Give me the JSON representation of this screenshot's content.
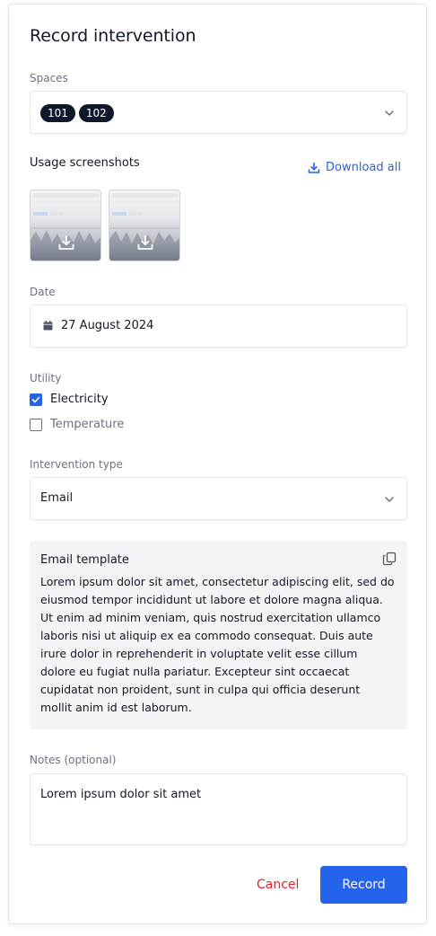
{
  "modal": {
    "title": "Record intervention"
  },
  "spaces": {
    "label": "Spaces",
    "chips": [
      "101",
      "102"
    ],
    "icon": "chevron-down-icon"
  },
  "screenshots": {
    "label": "Usage screenshots",
    "download_all_label": "Download all",
    "count": 2
  },
  "date": {
    "label": "Date",
    "value": "27 August 2024",
    "icon": "calendar-icon"
  },
  "utility": {
    "label": "Utility",
    "options": [
      {
        "label": "Electricity",
        "checked": true
      },
      {
        "label": "Temperature",
        "checked": false
      }
    ]
  },
  "intervention_type": {
    "label": "Intervention type",
    "value": "Email",
    "icon": "chevron-down-icon"
  },
  "email_template": {
    "title": "Email template",
    "body": "Lorem ipsum dolor sit amet, consectetur adipiscing elit, sed do eiusmod tempor incididunt ut labore et dolore magna aliqua. Ut enim ad minim veniam, quis nostrud exercitation ullamco laboris nisi ut aliquip ex ea commodo consequat. Duis aute irure dolor in reprehenderit in voluptate velit esse cillum dolore eu fugiat nulla pariatur. Excepteur sint occaecat cupidatat non proident, sunt in culpa qui officia deserunt mollit anim id est laborum.",
    "icon": "copy-icon"
  },
  "notes": {
    "label": "Notes (optional)",
    "value": "Lorem ipsum dolor sit amet"
  },
  "actions": {
    "cancel_label": "Cancel",
    "record_label": "Record"
  },
  "colors": {
    "accent": "#2563eb",
    "danger": "#dc2626",
    "chip": "#0f172a"
  }
}
